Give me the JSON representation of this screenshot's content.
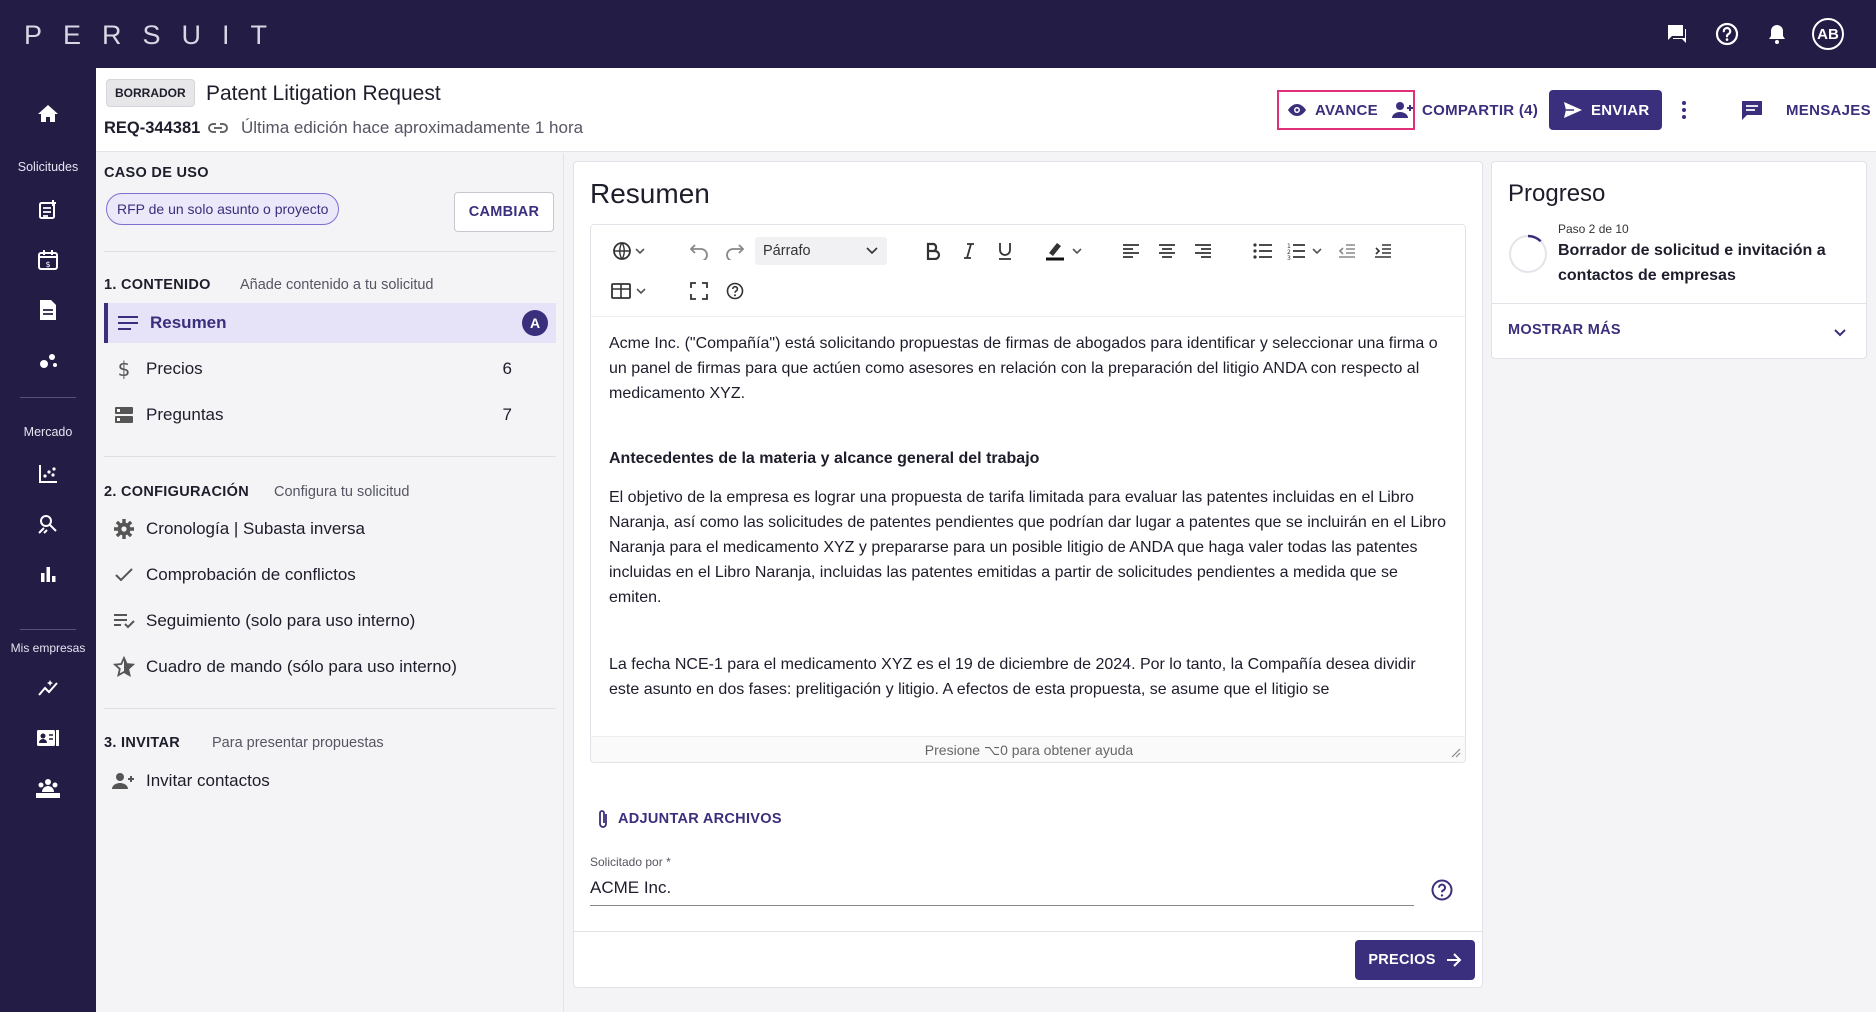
{
  "app": {
    "logo": "PERSUIT",
    "user_initials": "AB"
  },
  "topbar_icons": [
    "chat-icon",
    "help-icon",
    "bell-icon"
  ],
  "nav": {
    "solicitudes_label": "Solicitudes",
    "mercado_label": "Mercado",
    "empresas_label": "Mis empresas"
  },
  "header": {
    "status": "BORRADOR",
    "title": "Patent Litigation Request",
    "req_id": "REQ-344381",
    "edited": "Última edición hace aproximadamente 1 hora",
    "avance": "AVANCE",
    "compartir": "COMPARTIR (4)",
    "enviar": "ENVIAR",
    "mensajes": "MENSAJES"
  },
  "left": {
    "use_case_title": "CASO DE USO",
    "use_case_chip": "RFP de un solo asunto o proyecto",
    "cambiar": "CAMBIAR",
    "section1": {
      "title": "1. CONTENIDO",
      "sub": "Añade contenido a tu solicitud"
    },
    "content_items": [
      {
        "label": "Resumen",
        "badge": "A"
      },
      {
        "label": "Precios",
        "count": "6"
      },
      {
        "label": "Preguntas",
        "count": "7"
      }
    ],
    "section2": {
      "title": "2. CONFIGURACIÓN",
      "sub": "Configura tu solicitud"
    },
    "config_items": [
      {
        "label": "Cronología | Subasta inversa"
      },
      {
        "label": "Comprobación de conflictos"
      },
      {
        "label": "Seguimiento (solo para uso interno)"
      },
      {
        "label": "Cuadro de mando (sólo para uso interno)"
      }
    ],
    "section3": {
      "title": "3. INVITAR",
      "sub": "Para presentar propuestas"
    },
    "invite_items": [
      {
        "label": "Invitar contactos"
      }
    ]
  },
  "main": {
    "title": "Resumen",
    "toolbar": {
      "paragraph_select": "Párrafo"
    },
    "content": {
      "p1": "Acme Inc. (\"Compañía\") está solicitando propuestas de firmas de abogados para identificar y seleccionar una firma o un panel de firmas para que actúen como asesores en relación con la preparación del litigio ANDA con respecto al medicamento XYZ.",
      "h1": "Antecedentes de la materia y alcance general del trabajo",
      "p2": "El objetivo de la empresa es lograr una propuesta de tarifa limitada para evaluar las patentes incluidas en el Libro Naranja, así como las solicitudes de patentes pendientes que podrían dar lugar a patentes que se incluirán en el Libro Naranja para el medicamento XYZ y prepararse para un posible litigio de ANDA que haga valer todas las patentes incluidas en el Libro Naranja, incluidas las patentes emitidas a partir de solicitudes pendientes a medida que se emiten.",
      "p3": "La fecha NCE-1 para el medicamento XYZ es el 19 de diciembre de 2024. Por lo tanto, la Compañía desea dividir este asunto en dos fases: prelitigación y litigio. A efectos de esta propuesta, se asume que el litigio se"
    },
    "editor_hint": "Presione ⌥0 para obtener ayuda",
    "attach": "ADJUNTAR ARCHIVOS",
    "requested_by_label": "Solicitado por",
    "requested_by_required": "*",
    "requested_by_value": "ACME Inc.",
    "next_button": "PRECIOS"
  },
  "progress": {
    "title": "Progreso",
    "step": "Paso 2 de 10",
    "step_desc": "Borrador de solicitud e invitación a contactos de empresas",
    "show_more": "MOSTRAR MÁS"
  },
  "colors": {
    "primary": "#3a2f7c",
    "nav_bg": "#231c45",
    "highlight": "#e0307a"
  }
}
